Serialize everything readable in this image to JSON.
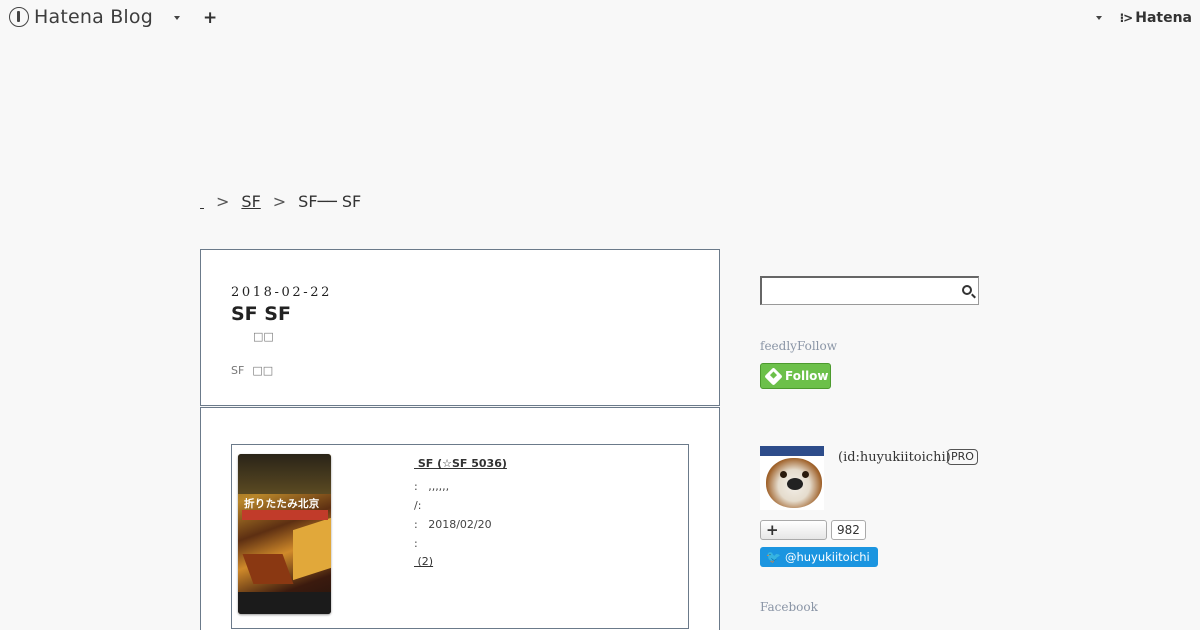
{
  "header": {
    "logo_text": "Hatena Blog",
    "add_symbol": "+",
    "hatena_label": "Hatena",
    "hatena_mark": "⁝>"
  },
  "breadcrumb": {
    "home_label": "",
    "separator": ">",
    "category_label": "SF",
    "current_label": "SF── SF"
  },
  "entry": {
    "date": "2018-02-22",
    "title": "SF SF",
    "subtitle": "□□",
    "category_prefix": "SF",
    "category_tag": "□□"
  },
  "book": {
    "title": " SF (☆SF 5036)",
    "authors_row": ":   ,,,,,,",
    "publisher_row": "/:",
    "date_row": ":   2018/02/20",
    "media_row": ":",
    "link_label": " (2)",
    "cover_text": "折りたたみ北京"
  },
  "sidebar": {
    "search_placeholder": "",
    "feedly_heading": "feedlyFollow",
    "feedly_button": "Follow",
    "profile_id": "(id:huyukiitoichi)",
    "pro_badge": "PRO",
    "subscribe_count": "982",
    "twitter_label": "@huyukiitoichi",
    "facebook_heading": "Facebook"
  },
  "colors": {
    "background": "#f8f8f8",
    "feedly_green": "#6cc04a",
    "twitter_blue": "#1b95e0",
    "box_border": "#6b7a8a"
  }
}
